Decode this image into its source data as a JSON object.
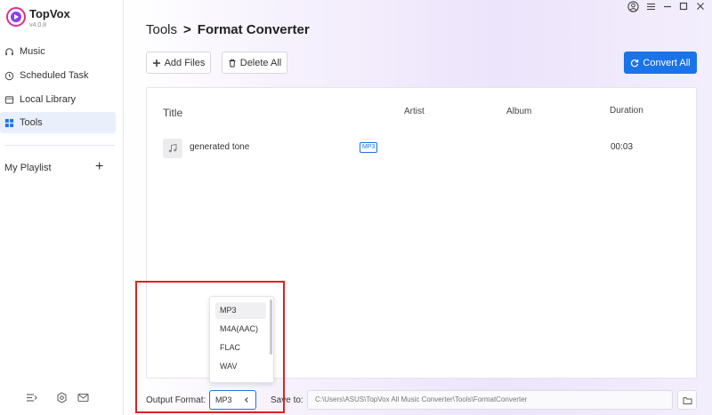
{
  "app": {
    "name": "TopVox",
    "version": "v4.0.8"
  },
  "sidebar": {
    "items": [
      {
        "label": "Music",
        "icon": "headphones-icon"
      },
      {
        "label": "Scheduled Task",
        "icon": "clock-icon"
      },
      {
        "label": "Local Library",
        "icon": "folder-icon"
      },
      {
        "label": "Tools",
        "icon": "grid-icon",
        "active": true
      }
    ],
    "playlist_label": "My Playlist",
    "playlist_add": "+"
  },
  "breadcrumb": {
    "root": "Tools",
    "separator": ">",
    "current": "Format Converter"
  },
  "toolbar": {
    "add_files": "Add Files",
    "delete_all": "Delete All",
    "convert_all": "Convert All"
  },
  "table": {
    "headers": {
      "title": "Title",
      "artist": "Artist",
      "album": "Album",
      "duration": "Duration"
    },
    "rows": [
      {
        "title": "generated tone",
        "format": "MP3",
        "artist": "",
        "album": "",
        "duration": "00:03"
      }
    ]
  },
  "output": {
    "label": "Output Format:",
    "selected": "MP3",
    "options": [
      "MP3",
      "M4A(AAC)",
      "FLAC",
      "WAV"
    ]
  },
  "save": {
    "label": "Save to:",
    "path": "C:\\Users\\ASUS\\TopVox All Music Converter\\Tools\\FormatConverter"
  },
  "colors": {
    "accent": "#1a73e8",
    "highlight": "#e02020"
  }
}
